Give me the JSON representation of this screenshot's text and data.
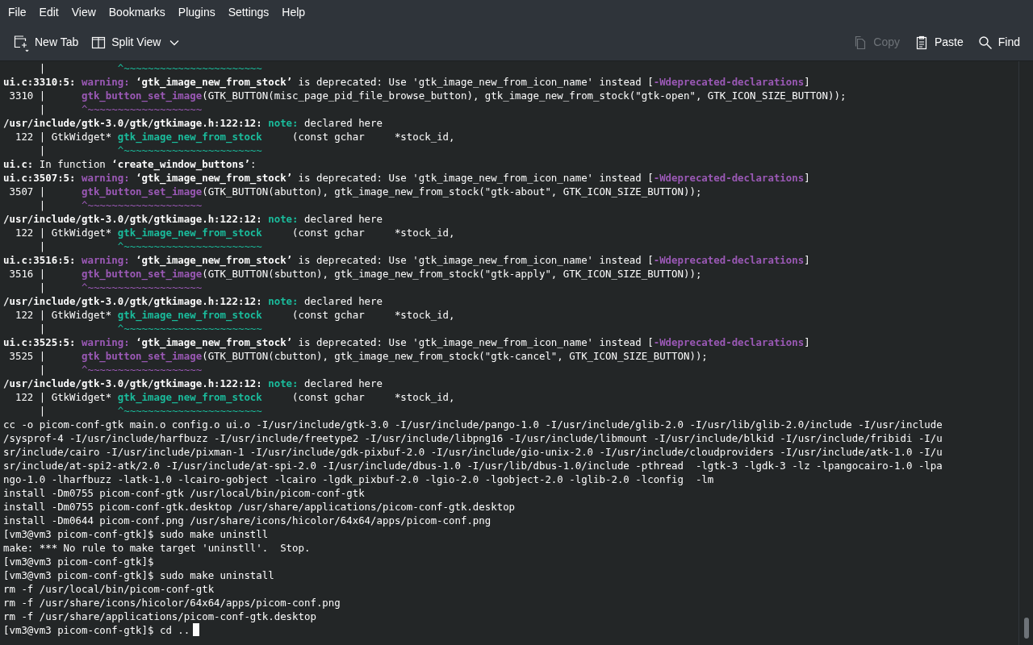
{
  "menu": [
    "File",
    "Edit",
    "View",
    "Bookmarks",
    "Plugins",
    "Settings",
    "Help"
  ],
  "toolbar_left": [
    {
      "kind": "new-tab",
      "label": "New Tab",
      "disabled": false
    },
    {
      "kind": "split-view",
      "label": "Split View",
      "disabled": false
    }
  ],
  "toolbar_right": [
    {
      "kind": "copy",
      "label": "Copy",
      "disabled": true
    },
    {
      "kind": "paste",
      "label": "Paste",
      "disabled": false
    },
    {
      "kind": "find",
      "label": "Find",
      "disabled": false
    }
  ],
  "terminal": {
    "lines": [
      {
        "segments": [
          "      |            ",
          {
            "text": "^~~~~~~~~~~~~~~~~~~~~~~~",
            "kind": "note-caret"
          }
        ]
      },
      {
        "segments": [
          {
            "text": "ui.c:3310:5:",
            "kind": "bold"
          },
          {
            "text": " warning:",
            "kind": "warning"
          },
          {
            "text": " ‘gtk_image_new_from_stock’",
            "kind": "bold"
          },
          " is deprecated: Use 'gtk_image_new_from_icon_name' instead [",
          {
            "text": "-Wdeprecated-declarations",
            "kind": "warning"
          },
          "]"
        ]
      },
      {
        "segments": [
          " 3310 |      ",
          {
            "text": "gtk_button_set_image",
            "kind": "warning"
          },
          "(GTK_BUTTON(misc_page_pid_file_browse_button), gtk_image_new_from_stock(\"gtk-open\", GTK_ICON_SIZE_BUTTON));"
        ]
      },
      {
        "segments": [
          "      |      ",
          {
            "text": "^~~~~~~~~~~~~~~~~~~~",
            "kind": "warning-caret"
          }
        ]
      },
      {
        "segments": [
          {
            "text": "/usr/include/gtk-3.0/gtk/gtkimage.h:122:12:",
            "kind": "bold"
          },
          {
            "text": " note:",
            "kind": "note"
          },
          " declared here"
        ]
      },
      {
        "segments": [
          "  122 | GtkWidget* ",
          {
            "text": "gtk_image_new_from_stock",
            "kind": "note"
          },
          "     (const gchar     *stock_id,"
        ]
      },
      {
        "segments": [
          "      |            ",
          {
            "text": "^~~~~~~~~~~~~~~~~~~~~~~~",
            "kind": "note-caret"
          }
        ]
      },
      {
        "segments": [
          {
            "text": "ui.c:",
            "kind": "bold"
          },
          " In function ",
          {
            "text": "‘create_window_buttons’",
            "kind": "bold"
          },
          ":"
        ]
      },
      {
        "segments": [
          {
            "text": "ui.c:3507:5:",
            "kind": "bold"
          },
          {
            "text": " warning:",
            "kind": "warning"
          },
          {
            "text": " ‘gtk_image_new_from_stock’",
            "kind": "bold"
          },
          " is deprecated: Use 'gtk_image_new_from_icon_name' instead [",
          {
            "text": "-Wdeprecated-declarations",
            "kind": "warning"
          },
          "]"
        ]
      },
      {
        "segments": [
          " 3507 |      ",
          {
            "text": "gtk_button_set_image",
            "kind": "warning"
          },
          "(GTK_BUTTON(abutton), gtk_image_new_from_stock(\"gtk-about\", GTK_ICON_SIZE_BUTTON));"
        ]
      },
      {
        "segments": [
          "      |      ",
          {
            "text": "^~~~~~~~~~~~~~~~~~~~",
            "kind": "warning-caret"
          }
        ]
      },
      {
        "segments": [
          {
            "text": "/usr/include/gtk-3.0/gtk/gtkimage.h:122:12:",
            "kind": "bold"
          },
          {
            "text": " note:",
            "kind": "note"
          },
          " declared here"
        ]
      },
      {
        "segments": [
          "  122 | GtkWidget* ",
          {
            "text": "gtk_image_new_from_stock",
            "kind": "note"
          },
          "     (const gchar     *stock_id,"
        ]
      },
      {
        "segments": [
          "      |            ",
          {
            "text": "^~~~~~~~~~~~~~~~~~~~~~~~",
            "kind": "note-caret"
          }
        ]
      },
      {
        "segments": [
          {
            "text": "ui.c:3516:5:",
            "kind": "bold"
          },
          {
            "text": " warning:",
            "kind": "warning"
          },
          {
            "text": " ‘gtk_image_new_from_stock’",
            "kind": "bold"
          },
          " is deprecated: Use 'gtk_image_new_from_icon_name' instead [",
          {
            "text": "-Wdeprecated-declarations",
            "kind": "warning"
          },
          "]"
        ]
      },
      {
        "segments": [
          " 3516 |      ",
          {
            "text": "gtk_button_set_image",
            "kind": "warning"
          },
          "(GTK_BUTTON(sbutton), gtk_image_new_from_stock(\"gtk-apply\", GTK_ICON_SIZE_BUTTON));"
        ]
      },
      {
        "segments": [
          "      |      ",
          {
            "text": "^~~~~~~~~~~~~~~~~~~~",
            "kind": "warning-caret"
          }
        ]
      },
      {
        "segments": [
          {
            "text": "/usr/include/gtk-3.0/gtk/gtkimage.h:122:12:",
            "kind": "bold"
          },
          {
            "text": " note:",
            "kind": "note"
          },
          " declared here"
        ]
      },
      {
        "segments": [
          "  122 | GtkWidget* ",
          {
            "text": "gtk_image_new_from_stock",
            "kind": "note"
          },
          "     (const gchar     *stock_id,"
        ]
      },
      {
        "segments": [
          "      |            ",
          {
            "text": "^~~~~~~~~~~~~~~~~~~~~~~~",
            "kind": "note-caret"
          }
        ]
      },
      {
        "segments": [
          {
            "text": "ui.c:3525:5:",
            "kind": "bold"
          },
          {
            "text": " warning:",
            "kind": "warning"
          },
          {
            "text": " ‘gtk_image_new_from_stock’",
            "kind": "bold"
          },
          " is deprecated: Use 'gtk_image_new_from_icon_name' instead [",
          {
            "text": "-Wdeprecated-declarations",
            "kind": "warning"
          },
          "]"
        ]
      },
      {
        "segments": [
          " 3525 |      ",
          {
            "text": "gtk_button_set_image",
            "kind": "warning"
          },
          "(GTK_BUTTON(cbutton), gtk_image_new_from_stock(\"gtk-cancel\", GTK_ICON_SIZE_BUTTON));"
        ]
      },
      {
        "segments": [
          "      |      ",
          {
            "text": "^~~~~~~~~~~~~~~~~~~~",
            "kind": "warning-caret"
          }
        ]
      },
      {
        "segments": [
          {
            "text": "/usr/include/gtk-3.0/gtk/gtkimage.h:122:12:",
            "kind": "bold"
          },
          {
            "text": " note:",
            "kind": "note"
          },
          " declared here"
        ]
      },
      {
        "segments": [
          "  122 | GtkWidget* ",
          {
            "text": "gtk_image_new_from_stock",
            "kind": "note"
          },
          "     (const gchar     *stock_id,"
        ]
      },
      {
        "segments": [
          "      |            ",
          {
            "text": "^~~~~~~~~~~~~~~~~~~~~~~~",
            "kind": "note-caret"
          }
        ]
      },
      {
        "segments": [
          "cc -o picom-conf-gtk main.o config.o ui.o -I/usr/include/gtk-3.0 -I/usr/include/pango-1.0 -I/usr/include/glib-2.0 -I/usr/lib/glib-2.0/include -I/usr/include"
        ]
      },
      {
        "segments": [
          "/sysprof-4 -I/usr/include/harfbuzz -I/usr/include/freetype2 -I/usr/include/libpng16 -I/usr/include/libmount -I/usr/include/blkid -I/usr/include/fribidi -I/u"
        ]
      },
      {
        "segments": [
          "sr/include/cairo -I/usr/include/pixman-1 -I/usr/include/gdk-pixbuf-2.0 -I/usr/include/gio-unix-2.0 -I/usr/include/cloudproviders -I/usr/include/atk-1.0 -I/u"
        ]
      },
      {
        "segments": [
          "sr/include/at-spi2-atk/2.0 -I/usr/include/at-spi-2.0 -I/usr/include/dbus-1.0 -I/usr/lib/dbus-1.0/include -pthread  -lgtk-3 -lgdk-3 -lz -lpangocairo-1.0 -lpa"
        ]
      },
      {
        "segments": [
          "ngo-1.0 -lharfbuzz -latk-1.0 -lcairo-gobject -lcairo -lgdk_pixbuf-2.0 -lgio-2.0 -lgobject-2.0 -lglib-2.0 -lconfig  -lm"
        ]
      },
      {
        "segments": [
          "install -Dm0755 picom-conf-gtk /usr/local/bin/picom-conf-gtk"
        ]
      },
      {
        "segments": [
          "install -Dm0755 picom-conf-gtk.desktop /usr/share/applications/picom-conf-gtk.desktop"
        ]
      },
      {
        "segments": [
          "install -Dm0644 picom-conf.png /usr/share/icons/hicolor/64x64/apps/picom-conf.png"
        ]
      },
      {
        "segments": [
          "[vm3@vm3 picom-conf-gtk]$ sudo make uninstll"
        ]
      },
      {
        "segments": [
          "make: *** No rule to make target 'uninstll'.  Stop."
        ]
      },
      {
        "segments": [
          "[vm3@vm3 picom-conf-gtk]$"
        ]
      },
      {
        "segments": [
          "[vm3@vm3 picom-conf-gtk]$ sudo make uninstall"
        ]
      },
      {
        "segments": [
          "rm -f /usr/local/bin/picom-conf-gtk"
        ]
      },
      {
        "segments": [
          "rm -f /usr/share/icons/hicolor/64x64/apps/picom-conf.png"
        ]
      },
      {
        "segments": [
          "rm -f /usr/share/applications/picom-conf-gtk.desktop"
        ]
      },
      {
        "segments": [
          "[vm3@vm3 picom-conf-gtk]$ cd .."
        ],
        "cursor": true
      }
    ]
  }
}
